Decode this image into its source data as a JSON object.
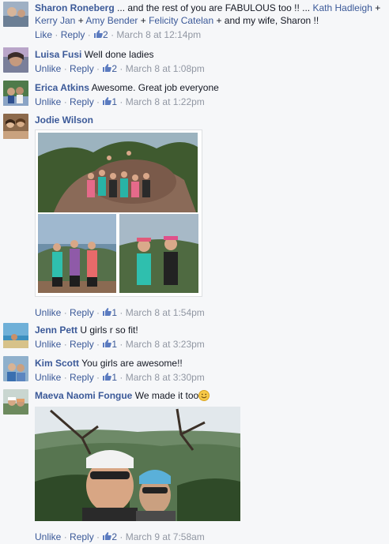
{
  "comments": [
    {
      "author": "Sharon Roneberg",
      "text_a": " ... and the rest of you are FABULOUS too !! ... ",
      "tag1": "Kath Hadleigh",
      "plus1": " + ",
      "tag2": "Kerry Jan",
      "plus2": " + ",
      "tag3": "Amy Bender",
      "plus3": " + ",
      "tag4": "Felicity Catelan",
      "text_b": " + and my wife, Sharon !!",
      "action": "Like",
      "reply": "Reply",
      "likes": "2",
      "time": "March 8 at 12:14pm"
    },
    {
      "author": "Luisa Fusi",
      "text": "Well done ladies",
      "action": "Unlike",
      "reply": "Reply",
      "likes": "2",
      "time": "March 8 at 1:08pm"
    },
    {
      "author": "Erica Atkins",
      "text": "Awesome. Great job everyone",
      "action": "Unlike",
      "reply": "Reply",
      "likes": "1",
      "time": "March 8 at 1:22pm"
    },
    {
      "author": "Jodie Wilson",
      "text": "",
      "action": "Unlike",
      "reply": "Reply",
      "likes": "1",
      "time": "March 8 at 1:54pm"
    },
    {
      "author": "Jenn Pett",
      "text": "U girls r so fit!",
      "action": "Unlike",
      "reply": "Reply",
      "likes": "1",
      "time": "March 8 at 3:23pm"
    },
    {
      "author": "Kim Scott",
      "text": "You girls are awesome!!",
      "action": "Unlike",
      "reply": "Reply",
      "likes": "1",
      "time": "March 8 at 3:30pm"
    },
    {
      "author": "Maeva Naomi Fongue",
      "text": "We made it too",
      "action": "Unlike",
      "reply": "Reply",
      "likes": "2",
      "time": "March 9 at 7:58am"
    }
  ],
  "separator": " · ",
  "icons": {
    "like": "thumbs-up-icon",
    "emoji": "smiley-emoji"
  },
  "colors": {
    "link": "#3b5998",
    "meta": "#9197a3",
    "background": "#f6f7f9"
  }
}
